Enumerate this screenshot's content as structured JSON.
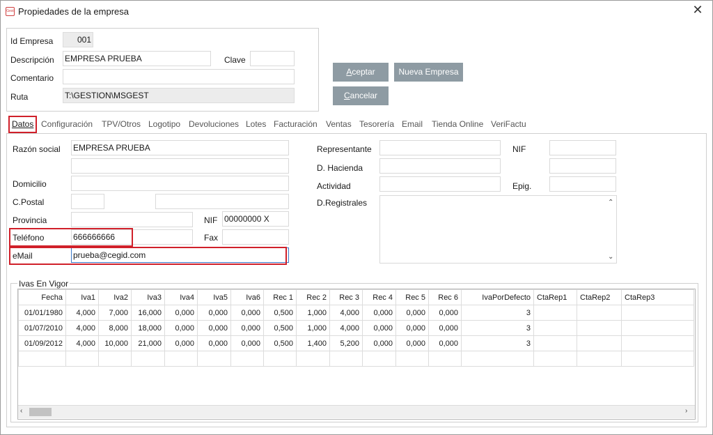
{
  "window": {
    "title": "Propiedades de la empresa",
    "icon": "app-logo-icon",
    "close_glyph": "✕"
  },
  "company": {
    "id_label": "Id Empresa",
    "id_value": "001",
    "desc_label": "Descripción",
    "desc_value": "EMPRESA PRUEBA",
    "clave_label": "Clave",
    "clave_value": "",
    "comment_label": "Comentario",
    "comment_value": "",
    "ruta_label": "Ruta",
    "ruta_value": "T:\\GESTION\\MSGEST"
  },
  "buttons": {
    "aceptar_first": "A",
    "aceptar_rest": "ceptar",
    "nueva": "Nueva Empresa",
    "cancelar_first": "C",
    "cancelar_rest": "ancelar"
  },
  "tabs": [
    {
      "label": "Datos"
    },
    {
      "label": "Configuración"
    },
    {
      "label": "TPV/Otros"
    },
    {
      "label": "Logotipo"
    },
    {
      "label": "Devoluciones"
    },
    {
      "label": "Lotes"
    },
    {
      "label": "Facturación"
    },
    {
      "label": "Ventas"
    },
    {
      "label": "Tesorería"
    },
    {
      "label": "Email"
    },
    {
      "label": "Tienda Online"
    },
    {
      "label": "VeriFactu"
    }
  ],
  "datos": {
    "razon_label": "Razón social",
    "razon_value": "EMPRESA PRUEBA",
    "razon2_value": "",
    "domicilio_label": "Domicilio",
    "domicilio_value": "",
    "cpostal_label": "C.Postal",
    "cpostal_value": "",
    "poblacion_value": "",
    "provincia_label": "Provincia",
    "provincia_value": "",
    "nif_label": "NIF",
    "nif_value": "00000000 X",
    "telefono_label": "Teléfono",
    "telefono_value": "666666666",
    "fax_label": "Fax",
    "fax_value": "",
    "email_label": "eMail",
    "email_value": "prueba@cegid.com",
    "representante_label": "Representante",
    "representante_value": "",
    "rep_nif_label": "NIF",
    "rep_nif_value": "",
    "hacienda_label": "D. Hacienda",
    "hacienda_value": "",
    "hacienda2_value": "",
    "actividad_label": "Actividad",
    "actividad_value": "",
    "epig_label": "Epig.",
    "epig_value": "",
    "registrales_label": "D.Registrales",
    "registrales_value": ""
  },
  "ivas": {
    "group_label": "Ivas En Vigor",
    "columns": [
      "Fecha",
      "Iva1",
      "Iva2",
      "Iva3",
      "Iva4",
      "Iva5",
      "Iva6",
      "Rec 1",
      "Rec 2",
      "Rec 3",
      "Rec 4",
      "Rec 5",
      "Rec 6",
      "IvaPorDefecto",
      "CtaRep1",
      "CtaRep2",
      "CtaRep3"
    ],
    "rows": [
      [
        "01/01/1980",
        "4,000",
        "7,000",
        "16,000",
        "0,000",
        "0,000",
        "0,000",
        "0,500",
        "1,000",
        "4,000",
        "0,000",
        "0,000",
        "0,000",
        "3",
        "",
        "",
        ""
      ],
      [
        "01/07/2010",
        "4,000",
        "8,000",
        "18,000",
        "0,000",
        "0,000",
        "0,000",
        "0,500",
        "1,000",
        "4,000",
        "0,000",
        "0,000",
        "0,000",
        "3",
        "",
        "",
        ""
      ],
      [
        "01/09/2012",
        "4,000",
        "10,000",
        "21,000",
        "0,000",
        "0,000",
        "0,000",
        "0,500",
        "1,400",
        "5,200",
        "0,000",
        "0,000",
        "0,000",
        "3",
        "",
        "",
        ""
      ],
      [
        "",
        "",
        "",
        "",
        "",
        "",
        "",
        "",
        "",
        "",
        "",
        "",
        "",
        "",
        "",
        "",
        ""
      ]
    ]
  }
}
